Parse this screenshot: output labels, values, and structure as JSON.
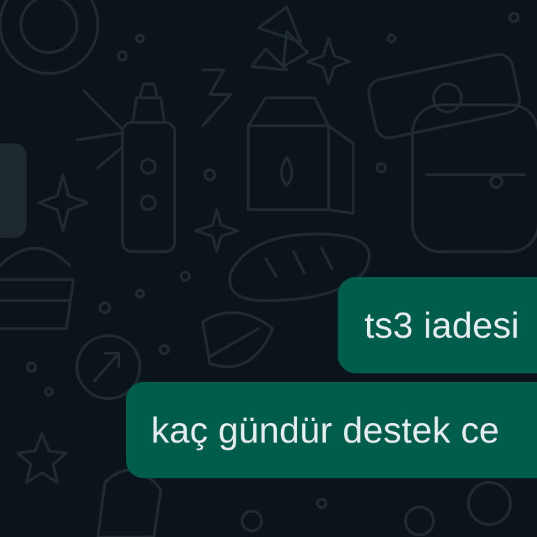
{
  "chat": {
    "background_color": "#0b141a",
    "outgoing_bubble_color": "#005c4b",
    "incoming_bubble_color": "#1e2a30",
    "text_color": "#e9edef",
    "messages": [
      {
        "direction": "outgoing",
        "text": "ts3 iadesi"
      },
      {
        "direction": "outgoing",
        "text": "kaç gündür destek ce"
      }
    ],
    "wallpaper_icons": [
      "frame-icon",
      "bottle-icon",
      "milk-carton-icon",
      "backpack-icon",
      "sparkle-icon",
      "bread-icon",
      "leaf-icon",
      "pinwheel-icon",
      "lightning-icon",
      "cupcake-icon",
      "star-icon"
    ]
  }
}
